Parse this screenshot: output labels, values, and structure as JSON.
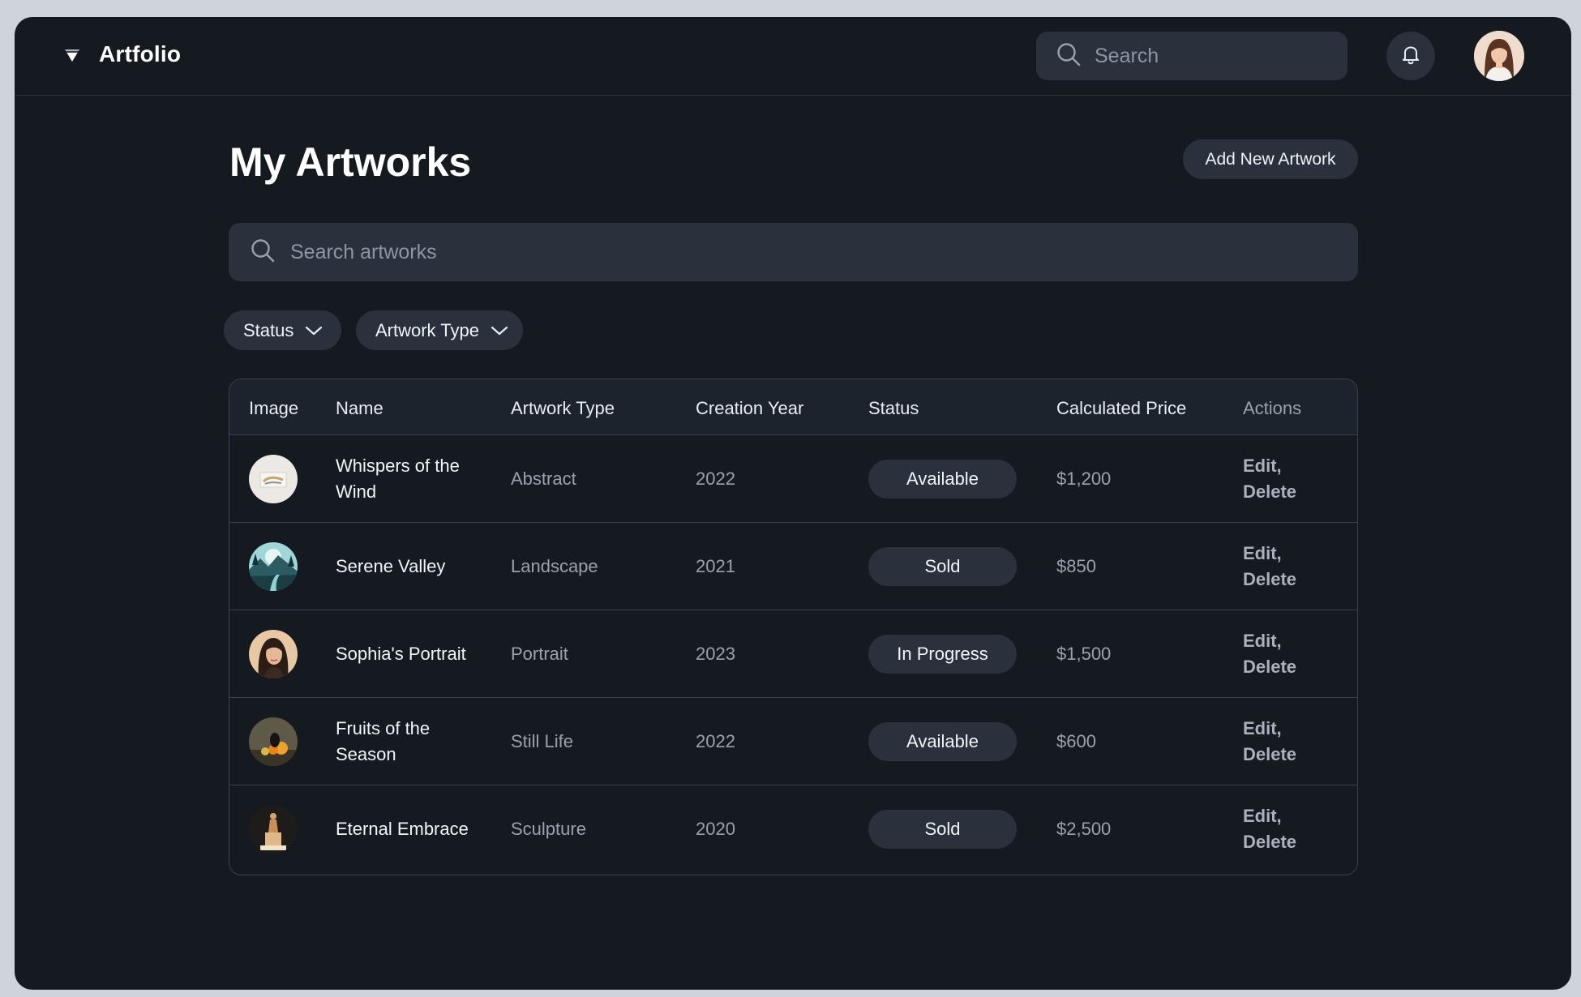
{
  "app": {
    "name": "Artfolio"
  },
  "topbar": {
    "search_placeholder": "Search"
  },
  "page": {
    "title": "My Artworks",
    "add_button": "Add New Artwork",
    "search_placeholder": "Search artworks"
  },
  "filters": {
    "status": "Status",
    "type": "Artwork Type"
  },
  "table": {
    "headers": {
      "image": "Image",
      "name": "Name",
      "type": "Artwork Type",
      "year": "Creation Year",
      "status": "Status",
      "price": "Calculated Price",
      "actions": "Actions"
    },
    "rows": [
      {
        "name": "Whispers of the Wind",
        "type": "Abstract",
        "year": "2022",
        "status": "Available",
        "price": "$1,200",
        "edit": "Edit,",
        "delete": "Delete",
        "thumb": "abstract-thumb"
      },
      {
        "name": "Serene Valley",
        "type": "Landscape",
        "year": "2021",
        "status": "Sold",
        "price": "$850",
        "edit": "Edit,",
        "delete": "Delete",
        "thumb": "landscape-thumb"
      },
      {
        "name": "Sophia's Portrait",
        "type": "Portrait",
        "year": "2023",
        "status": "In Progress",
        "price": "$1,500",
        "edit": "Edit,",
        "delete": "Delete",
        "thumb": "portrait-thumb"
      },
      {
        "name": "Fruits of the Season",
        "type": "Still Life",
        "year": "2022",
        "status": "Available",
        "price": "$600",
        "edit": "Edit,",
        "delete": "Delete",
        "thumb": "still-life-thumb"
      },
      {
        "name": "Eternal Embrace",
        "type": "Sculpture",
        "year": "2020",
        "status": "Sold",
        "price": "$2,500",
        "edit": "Edit,",
        "delete": "Delete",
        "thumb": "sculpture-thumb"
      }
    ]
  },
  "icons": {
    "logo": "diamond-logo-icon",
    "search": "search-icon",
    "bell": "bell-icon",
    "chevron": "chevron-down-icon"
  },
  "colors": {
    "background": "#151a21",
    "surface": "#2a313c",
    "border": "#3a424d"
  }
}
